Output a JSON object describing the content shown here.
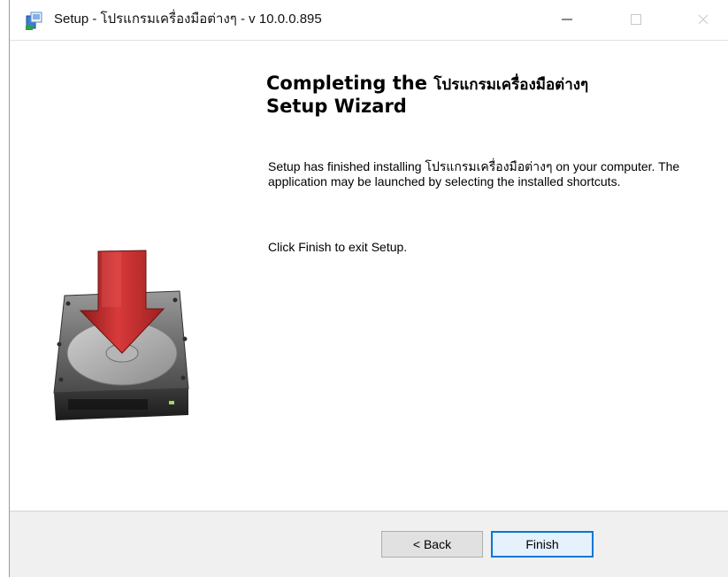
{
  "window": {
    "title": "Setup - โปรแกรมเครื่องมือต่างๆ - v 10.0.0.895",
    "icons": [
      "setup-app-icon",
      "minimize-icon",
      "maximize-icon",
      "close-icon"
    ]
  },
  "main": {
    "heading_part1": "Completing the",
    "heading_thai": "โปรแกรมเครื่องมือต่างๆ",
    "heading_part2": "Setup Wizard",
    "description": "Setup has finished installing โปรแกรมเครื่องมือต่างๆ on your computer. The application may be launched by selecting the installed shortcuts.",
    "instruction": "Click Finish to exit Setup.",
    "graphic": "hard-drive-download-icon"
  },
  "footer": {
    "back_label": "< Back",
    "finish_label": "Finish"
  },
  "colors": {
    "accent": "#0078d7",
    "footer_bg": "#f0f0f0",
    "button_bg": "#e1e1e1",
    "arrow_red": "#c62828"
  }
}
